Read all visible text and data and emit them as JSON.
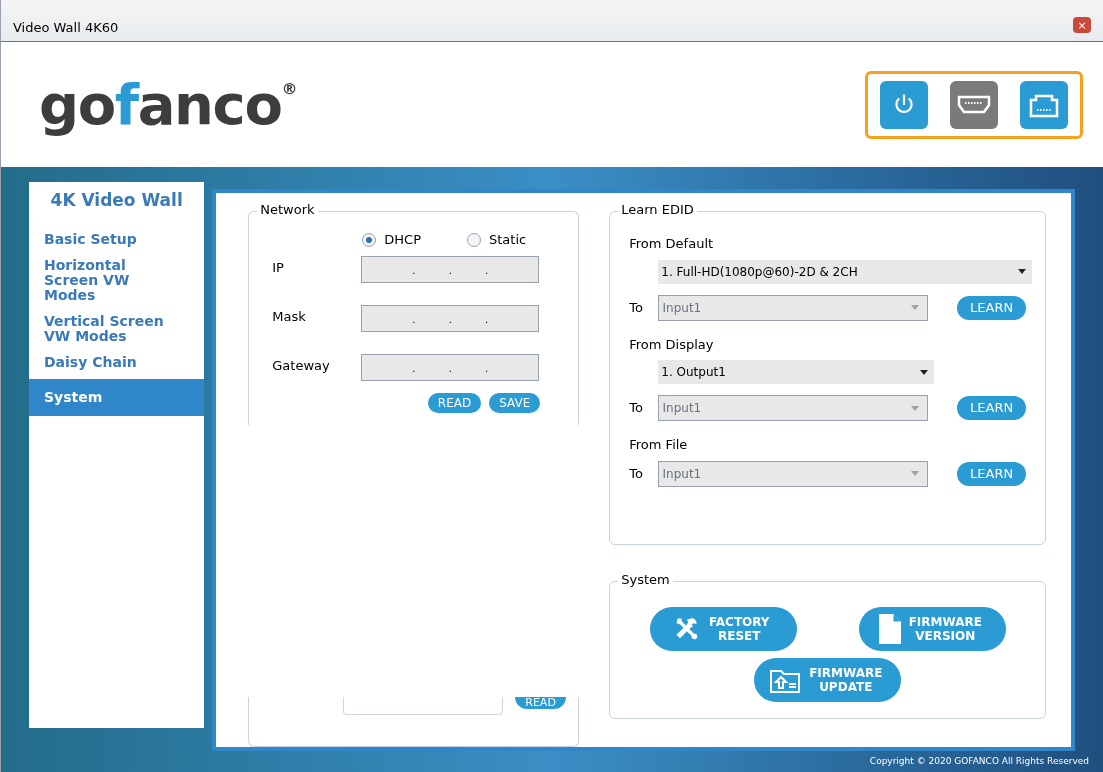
{
  "window": {
    "title": "Video Wall 4K60",
    "close": "×"
  },
  "header": {
    "logo": "gofanco",
    "logo_mark": "®",
    "icon_buttons": [
      {
        "kind": "power",
        "disabled": false
      },
      {
        "kind": "hdmi",
        "disabled": true
      },
      {
        "kind": "ethernet",
        "disabled": false
      }
    ]
  },
  "sidebar": {
    "title": "4K Video Wall",
    "items": [
      {
        "label": "Basic Setup",
        "selected": false
      },
      {
        "label": "Horizontal Screen VW Modes",
        "selected": false
      },
      {
        "label": "Vertical Screen VW Modes",
        "selected": false
      },
      {
        "label": "Daisy Chain",
        "selected": false
      },
      {
        "label": "System",
        "selected": true
      }
    ]
  },
  "network": {
    "title": "Network",
    "modes": [
      {
        "label": "DHCP",
        "selected": true
      },
      {
        "label": "Static",
        "selected": false
      }
    ],
    "fields": [
      {
        "label": "IP",
        "value": ". . ."
      },
      {
        "label": "Mask",
        "value": ". . ."
      },
      {
        "label": "Gateway",
        "value": ". . ."
      }
    ],
    "buttons": [
      "READ",
      "SAVE"
    ],
    "lower_button": "READ"
  },
  "learn_edid": {
    "title": "Learn EDID",
    "sections": [
      {
        "kind": "default",
        "label": "From Default",
        "source": "1. Full-HD(1080p@60)-2D & 2CH",
        "to": "To",
        "target": "Input1",
        "button": "LEARN"
      },
      {
        "kind": "display",
        "label": "From Display",
        "source": "1. Output1",
        "to": "To",
        "target": "Input1",
        "button": "LEARN"
      },
      {
        "kind": "file",
        "label": "From File",
        "to": "To",
        "target": "Input1",
        "button": "LEARN"
      }
    ]
  },
  "system": {
    "title": "System",
    "buttons": [
      {
        "kind": "reset",
        "lines": [
          "FACTORY",
          "RESET"
        ]
      },
      {
        "kind": "version",
        "lines": [
          "FIRMWARE",
          "VERSION"
        ]
      },
      {
        "kind": "update",
        "lines": [
          "FIRMWARE",
          "UPDATE"
        ]
      }
    ]
  },
  "footer": {
    "copyright": "Copyright © 2020 GOFANCO All Rights Reserved"
  }
}
